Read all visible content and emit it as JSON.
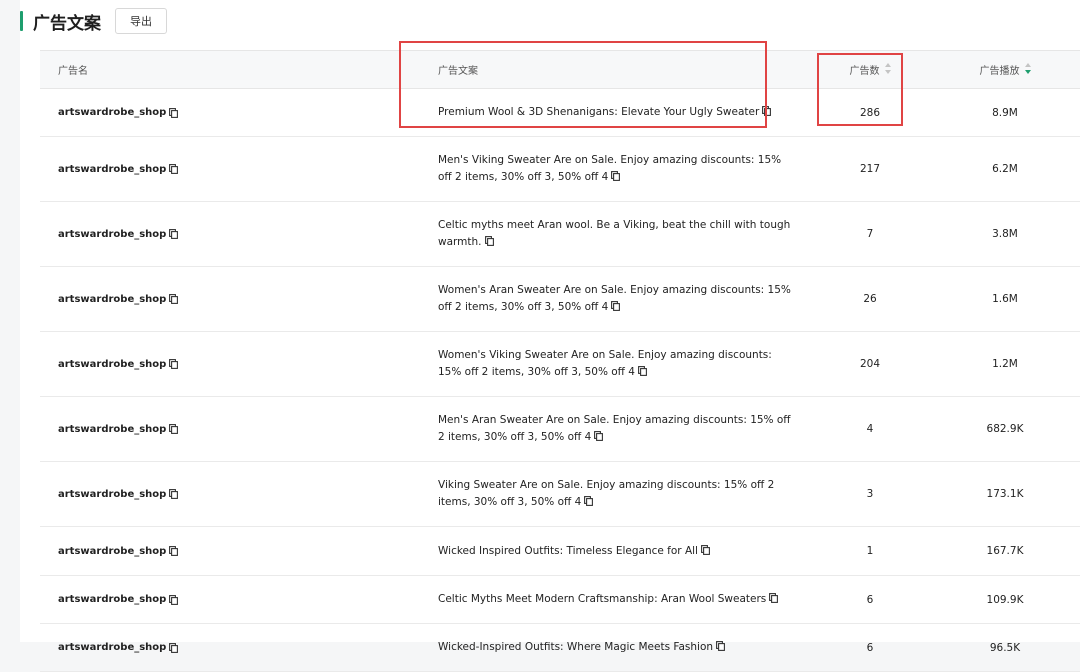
{
  "header": {
    "title": "广告文案",
    "export_label": "导出"
  },
  "table": {
    "columns": {
      "ad_name": "广告名",
      "ad_copy": "广告文案",
      "ad_count": "广告数",
      "ad_plays": "广告播放"
    },
    "rows": [
      {
        "name": "artswardrobe_shop",
        "copy": "Premium Wool & 3D Shenanigans: Elevate Your Ugly Sweater",
        "count": "286",
        "plays": "8.9M"
      },
      {
        "name": "artswardrobe_shop",
        "copy": "Men's Viking Sweater Are on Sale. Enjoy amazing discounts: 15% off 2 items, 30% off 3, 50% off 4",
        "count": "217",
        "plays": "6.2M"
      },
      {
        "name": "artswardrobe_shop",
        "copy": "Celtic myths meet Aran wool. Be a Viking, beat the chill with tough warmth.",
        "count": "7",
        "plays": "3.8M"
      },
      {
        "name": "artswardrobe_shop",
        "copy": "Women's Aran Sweater Are on Sale. Enjoy amazing discounts: 15% off 2 items, 30% off 3, 50% off 4",
        "count": "26",
        "plays": "1.6M"
      },
      {
        "name": "artswardrobe_shop",
        "copy": "Women's Viking Sweater Are on Sale. Enjoy amazing discounts: 15% off 2 items, 30% off 3, 50% off 4",
        "count": "204",
        "plays": "1.2M"
      },
      {
        "name": "artswardrobe_shop",
        "copy": "Men's Aran Sweater Are on Sale. Enjoy amazing discounts: 15% off 2 items, 30% off 3, 50% off 4",
        "count": "4",
        "plays": "682.9K"
      },
      {
        "name": "artswardrobe_shop",
        "copy": "Viking Sweater Are on Sale. Enjoy amazing discounts: 15% off 2 items, 30% off 3, 50% off 4",
        "count": "3",
        "plays": "173.1K"
      },
      {
        "name": "artswardrobe_shop",
        "copy": "Wicked Inspired Outfits: Timeless Elegance for All",
        "count": "1",
        "plays": "167.7K"
      },
      {
        "name": "artswardrobe_shop",
        "copy": "Celtic Myths Meet Modern Craftsmanship: Aran Wool Sweaters",
        "count": "6",
        "plays": "109.9K"
      },
      {
        "name": "artswardrobe_shop",
        "copy": "Wicked-Inspired Outfits: Where Magic Meets Fashion",
        "count": "6",
        "plays": "96.5K"
      }
    ]
  },
  "icons": {
    "copy": "copy-icon",
    "sort_neutral": "sort-icon",
    "sort_desc": "sort-desc-icon"
  },
  "colors": {
    "accent": "#1e9e6e",
    "highlight": "#e04444",
    "sort_active": "#1e9e6e"
  }
}
